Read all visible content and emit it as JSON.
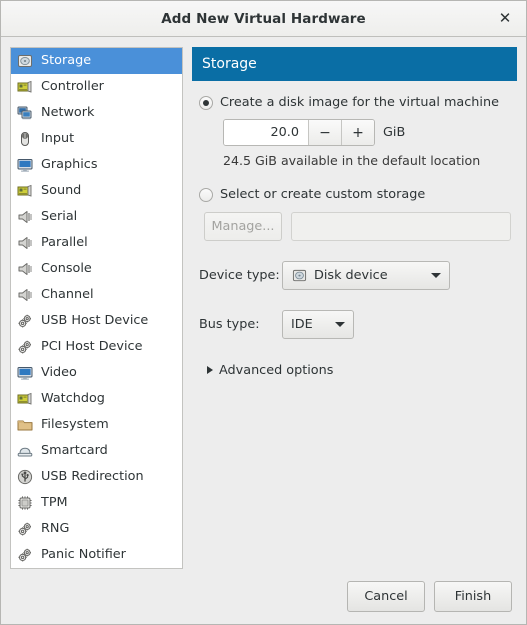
{
  "window": {
    "title": "Add New Virtual Hardware",
    "close_label": "✕"
  },
  "sidebar": {
    "items": [
      {
        "label": "Storage",
        "icon": "disk-icon",
        "selected": true
      },
      {
        "label": "Controller",
        "icon": "controller-icon",
        "selected": false
      },
      {
        "label": "Network",
        "icon": "network-icon",
        "selected": false
      },
      {
        "label": "Input",
        "icon": "mouse-icon",
        "selected": false
      },
      {
        "label": "Graphics",
        "icon": "display-icon",
        "selected": false
      },
      {
        "label": "Sound",
        "icon": "soundcard-icon",
        "selected": false
      },
      {
        "label": "Serial",
        "icon": "speaker-icon",
        "selected": false
      },
      {
        "label": "Parallel",
        "icon": "speaker-icon",
        "selected": false
      },
      {
        "label": "Console",
        "icon": "speaker-icon",
        "selected": false
      },
      {
        "label": "Channel",
        "icon": "speaker-icon",
        "selected": false
      },
      {
        "label": "USB Host Device",
        "icon": "gears-icon",
        "selected": false
      },
      {
        "label": "PCI Host Device",
        "icon": "gears-icon",
        "selected": false
      },
      {
        "label": "Video",
        "icon": "display-icon",
        "selected": false
      },
      {
        "label": "Watchdog",
        "icon": "controller-icon",
        "selected": false
      },
      {
        "label": "Filesystem",
        "icon": "folder-icon",
        "selected": false
      },
      {
        "label": "Smartcard",
        "icon": "smartcard-icon",
        "selected": false
      },
      {
        "label": "USB Redirection",
        "icon": "usb-icon",
        "selected": false
      },
      {
        "label": "TPM",
        "icon": "chip-icon",
        "selected": false
      },
      {
        "label": "RNG",
        "icon": "gears-icon",
        "selected": false
      },
      {
        "label": "Panic Notifier",
        "icon": "gears-icon",
        "selected": false
      }
    ]
  },
  "pane": {
    "header": "Storage",
    "create_disk": {
      "label": "Create a disk image for the virtual machine",
      "selected": true,
      "size_value": "20.0",
      "minus_label": "−",
      "plus_label": "+",
      "unit": "GiB",
      "note": "24.5 GiB available in the default location"
    },
    "custom_storage": {
      "label": "Select or create custom storage",
      "selected": false,
      "manage_label": "Manage...",
      "path_value": "",
      "path_placeholder": ""
    },
    "device_type": {
      "label": "Device type:",
      "value": "Disk device",
      "icon": "disk-icon"
    },
    "bus_type": {
      "label": "Bus type:",
      "value": "IDE"
    },
    "advanced_label": "Advanced options"
  },
  "footer": {
    "cancel_label": "Cancel",
    "finish_label": "Finish"
  },
  "colors": {
    "header_blue": "#0a6ea5",
    "selection_blue": "#4a90d9",
    "window_bg": "#ededed"
  }
}
